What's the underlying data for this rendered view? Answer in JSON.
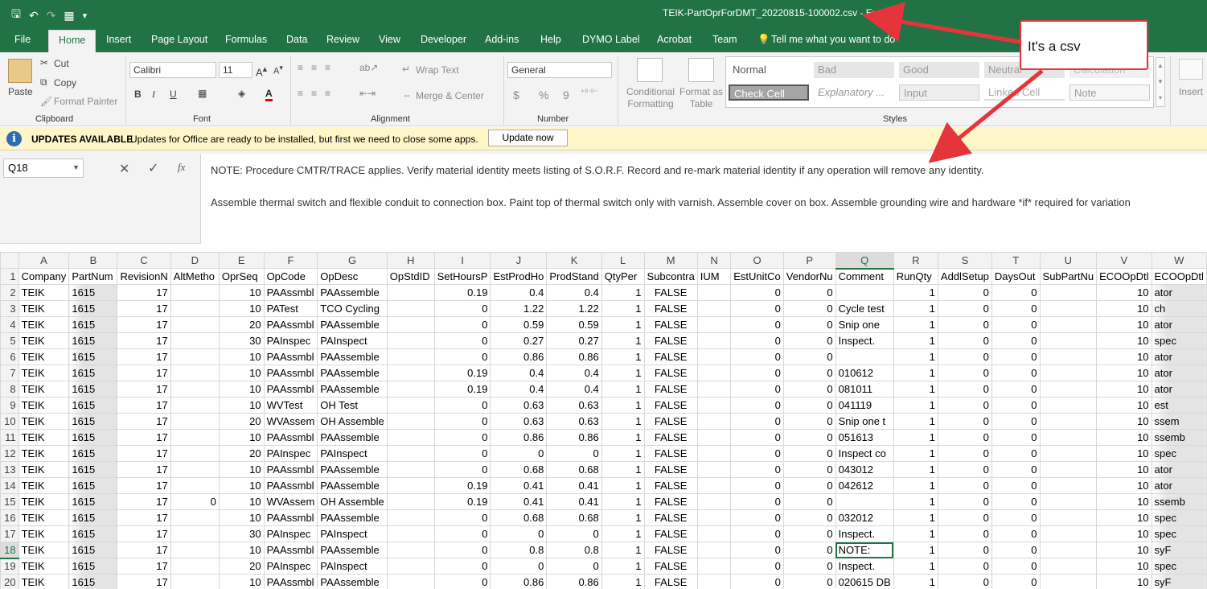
{
  "window": {
    "title": "TEIK-PartOprForDMT_20220815-100002.csv  -  Excel"
  },
  "qat": {
    "icons": [
      "save-icon",
      "undo-icon",
      "redo-icon",
      "customize-icon",
      "more-icon"
    ],
    "save": "🖫",
    "undo": "↶",
    "redo": "↷",
    "custom": "▦",
    "more": "▾"
  },
  "tabs": [
    "File",
    "Home",
    "Insert",
    "Page Layout",
    "Formulas",
    "Data",
    "Review",
    "View",
    "Developer",
    "Add-ins",
    "Help",
    "DYMO Label",
    "Acrobat",
    "Team"
  ],
  "tellme": "Tell me what you want to do",
  "ribbon": {
    "clipboard": {
      "paste": "Paste",
      "cut": "Cut",
      "copy": "Copy",
      "format_painter": "Format Painter",
      "label": "Clipboard"
    },
    "font": {
      "name": "Calibri",
      "size": "11",
      "label": "Font",
      "bold": "B",
      "italic": "I",
      "underline": "U",
      "font_color": "A"
    },
    "alignment": {
      "wrap": "Wrap Text",
      "merge": "Merge & Center",
      "label": "Alignment"
    },
    "number": {
      "format": "General",
      "currency": "$",
      "percent": "%",
      "comma": "9",
      "label": "Number"
    },
    "styles": {
      "conditional": [
        "Conditional",
        "Formatting"
      ],
      "format_table": [
        "Format as",
        "Table"
      ],
      "cells": [
        "Normal",
        "Bad",
        "Good",
        "Neutral",
        "Calculation",
        "Check Cell",
        "Explanatory ...",
        "Input",
        "Linked Cell",
        "Note"
      ],
      "label": "Styles"
    },
    "insert": "Insert"
  },
  "msgbar": {
    "title": "UPDATES AVAILABLE",
    "text": "Updates for Office are ready to be installed, but first we need to close some apps.",
    "button": "Update now",
    "icon": "i"
  },
  "formula_bar": {
    "name_box": "Q18",
    "fx": "fx",
    "line1": "NOTE: Procedure CMTR/TRACE applies. Verify material identity meets listing of S.O.R.F. Record and re-mark material identity if any operation will remove any identity.",
    "line2": "Assemble thermal switch and flexible conduit to connection box. Paint top of thermal switch only with varnish. Assemble cover on box. Assemble grounding wire and hardware *if* required for variation"
  },
  "sheet": {
    "columns": [
      "A",
      "B",
      "C",
      "D",
      "E",
      "F",
      "G",
      "H",
      "I",
      "J",
      "K",
      "L",
      "M",
      "N",
      "O",
      "P",
      "Q",
      "R",
      "S",
      "T",
      "U",
      "V",
      "W"
    ],
    "selected_column": "Q",
    "selected_row": 18,
    "headers": [
      "Company",
      "PartNum",
      "RevisionN",
      "AltMetho",
      "OprSeq",
      "OpCode",
      "OpDesc",
      "OpStdID",
      "SetHoursP",
      "EstProdHo",
      "ProdStand",
      "QtyPer",
      "Subcontra",
      "IUM",
      "EstUnitCo",
      "VendorNu",
      "Comment",
      "RunQty",
      "AddlSetup",
      "DaysOut",
      "SubPartNu",
      "ECOOpDtl",
      "ECOOpDtl"
    ],
    "rows": [
      [
        "TEIK",
        "1615",
        "17",
        "",
        "10",
        "PAAssmbl",
        "PAAssemble",
        "",
        "0.19",
        "0.4",
        "0.4",
        "1",
        "FALSE",
        "",
        "0",
        "0",
        "",
        "1",
        "0",
        "0",
        "",
        "10",
        "ator"
      ],
      [
        "TEIK",
        "1615",
        "17",
        "",
        "10",
        "PATest",
        "TCO Cycling",
        "",
        "0",
        "1.22",
        "1.22",
        "1",
        "FALSE",
        "",
        "0",
        "0",
        "Cycle test",
        "1",
        "0",
        "0",
        "",
        "10",
        "ch"
      ],
      [
        "TEIK",
        "1615",
        "17",
        "",
        "20",
        "PAAssmbl",
        "PAAssemble",
        "",
        "0",
        "0.59",
        "0.59",
        "1",
        "FALSE",
        "",
        "0",
        "0",
        "Snip one",
        "1",
        "0",
        "0",
        "",
        "10",
        "ator"
      ],
      [
        "TEIK",
        "1615",
        "17",
        "",
        "30",
        "PAInspec",
        "PAInspect",
        "",
        "0",
        "0.27",
        "0.27",
        "1",
        "FALSE",
        "",
        "0",
        "0",
        "Inspect.",
        "1",
        "0",
        "0",
        "",
        "10",
        "spec"
      ],
      [
        "TEIK",
        "1615",
        "17",
        "",
        "10",
        "PAAssmbl",
        "PAAssemble",
        "",
        "0",
        "0.86",
        "0.86",
        "1",
        "FALSE",
        "",
        "0",
        "0",
        "",
        "1",
        "0",
        "0",
        "",
        "10",
        "ator"
      ],
      [
        "TEIK",
        "1615",
        "17",
        "",
        "10",
        "PAAssmbl",
        "PAAssemble",
        "",
        "0.19",
        "0.4",
        "0.4",
        "1",
        "FALSE",
        "",
        "0",
        "0",
        "010612",
        "1",
        "0",
        "0",
        "",
        "10",
        "ator"
      ],
      [
        "TEIK",
        "1615",
        "17",
        "",
        "10",
        "PAAssmbl",
        "PAAssemble",
        "",
        "0.19",
        "0.4",
        "0.4",
        "1",
        "FALSE",
        "",
        "0",
        "0",
        "081011",
        "1",
        "0",
        "0",
        "",
        "10",
        "ator"
      ],
      [
        "TEIK",
        "1615",
        "17",
        "",
        "10",
        "WVTest",
        "OH Test",
        "",
        "0",
        "0.63",
        "0.63",
        "1",
        "FALSE",
        "",
        "0",
        "0",
        "041119",
        "1",
        "0",
        "0",
        "",
        "10",
        "est"
      ],
      [
        "TEIK",
        "1615",
        "17",
        "",
        "20",
        "WVAssem",
        "OH Assemble",
        "",
        "0",
        "0.63",
        "0.63",
        "1",
        "FALSE",
        "",
        "0",
        "0",
        "Snip one t",
        "1",
        "0",
        "0",
        "",
        "10",
        "ssem"
      ],
      [
        "TEIK",
        "1615",
        "17",
        "",
        "10",
        "PAAssmbl",
        "PAAssemble",
        "",
        "0",
        "0.86",
        "0.86",
        "1",
        "FALSE",
        "",
        "0",
        "0",
        "051613",
        "1",
        "0",
        "0",
        "",
        "10",
        "ssemb"
      ],
      [
        "TEIK",
        "1615",
        "17",
        "",
        "20",
        "PAInspec",
        "PAInspect",
        "",
        "0",
        "0",
        "0",
        "1",
        "FALSE",
        "",
        "0",
        "0",
        "Inspect co",
        "1",
        "0",
        "0",
        "",
        "10",
        "spec"
      ],
      [
        "TEIK",
        "1615",
        "17",
        "",
        "10",
        "PAAssmbl",
        "PAAssemble",
        "",
        "0",
        "0.68",
        "0.68",
        "1",
        "FALSE",
        "",
        "0",
        "0",
        "043012",
        "1",
        "0",
        "0",
        "",
        "10",
        "ator"
      ],
      [
        "TEIK",
        "1615",
        "17",
        "",
        "10",
        "PAAssmbl",
        "PAAssemble",
        "",
        "0.19",
        "0.41",
        "0.41",
        "1",
        "FALSE",
        "",
        "0",
        "0",
        "042612",
        "1",
        "0",
        "0",
        "",
        "10",
        "ator"
      ],
      [
        "TEIK",
        "1615",
        "17",
        "0",
        "10",
        "WVAssem",
        "OH Assemble",
        "",
        "0.19",
        "0.41",
        "0.41",
        "1",
        "FALSE",
        "",
        "0",
        "0",
        "",
        "1",
        "0",
        "0",
        "",
        "10",
        "ssemb"
      ],
      [
        "TEIK",
        "1615",
        "17",
        "",
        "10",
        "PAAssmbl",
        "PAAssemble",
        "",
        "0",
        "0.68",
        "0.68",
        "1",
        "FALSE",
        "",
        "0",
        "0",
        "032012",
        "1",
        "0",
        "0",
        "",
        "10",
        "spec"
      ],
      [
        "TEIK",
        "1615",
        "17",
        "",
        "30",
        "PAInspec",
        "PAInspect",
        "",
        "0",
        "0",
        "0",
        "1",
        "FALSE",
        "",
        "0",
        "0",
        "Inspect.",
        "1",
        "0",
        "0",
        "",
        "10",
        "spec"
      ],
      [
        "TEIK",
        "1615",
        "17",
        "",
        "10",
        "PAAssmbl",
        "PAAssemble",
        "",
        "0",
        "0.8",
        "0.8",
        "1",
        "FALSE",
        "",
        "0",
        "0",
        "NOTE:",
        "1",
        "0",
        "0",
        "",
        "10",
        "syF"
      ],
      [
        "TEIK",
        "1615",
        "17",
        "",
        "20",
        "PAInspec",
        "PAInspect",
        "",
        "0",
        "0",
        "0",
        "1",
        "FALSE",
        "",
        "0",
        "0",
        "Inspect.",
        "1",
        "0",
        "0",
        "",
        "10",
        "spec"
      ],
      [
        "TEIK",
        "1615",
        "17",
        "",
        "10",
        "PAAssmbl",
        "PAAssemble",
        "",
        "0",
        "0.86",
        "0.86",
        "1",
        "FALSE",
        "",
        "0",
        "0",
        "020615 DB",
        "1",
        "0",
        "0",
        "",
        "10",
        "syF"
      ]
    ]
  },
  "annotation": {
    "callout": "It's a csv",
    "color": "#e5353b"
  },
  "colors": {
    "excel_green": "#217346",
    "ribbon_bg": "#f3f3f3",
    "message_bar": "#fff6c7"
  }
}
